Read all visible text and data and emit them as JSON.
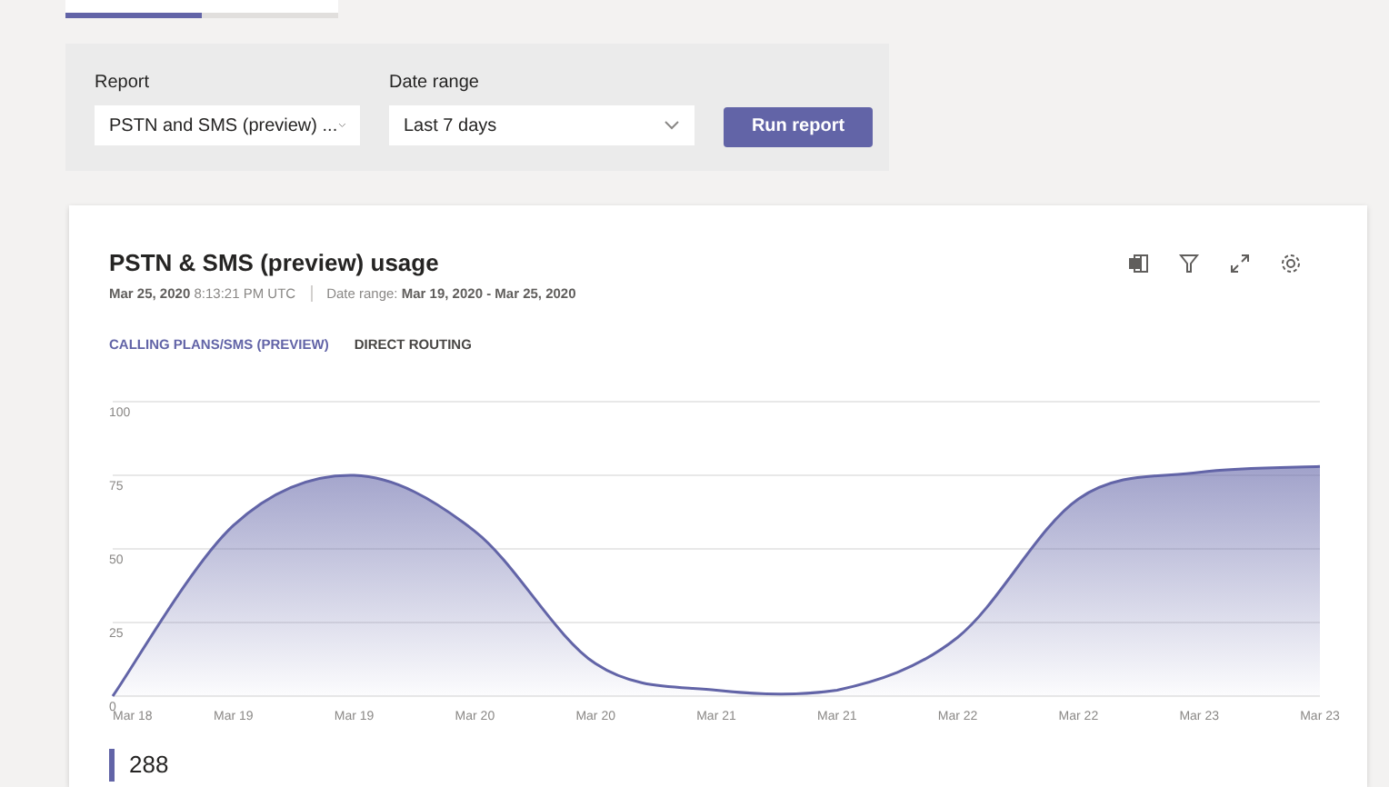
{
  "tabs": [
    {
      "selected": true
    },
    {
      "selected": false
    }
  ],
  "filters": {
    "report_label": "Report",
    "report_value": "PSTN and SMS (preview) ...",
    "date_label": "Date range",
    "date_value": "Last 7 days",
    "run_button": "Run report"
  },
  "card": {
    "title": "PSTN & SMS (preview) usage",
    "timestamp_date": "Mar 25, 2020",
    "timestamp_time": "8:13:21 PM UTC",
    "range_label": "Date range:",
    "range_value": "Mar 19, 2020 - Mar 25, 2020",
    "tabs": [
      {
        "label": "CALLING PLANS/SMS (PREVIEW)",
        "selected": true
      },
      {
        "label": "DIRECT ROUTING",
        "selected": false
      }
    ],
    "chart_data": {
      "type": "area",
      "categories": [
        "Mar 18",
        "Mar 19",
        "Mar 19",
        "Mar 20",
        "Mar 20",
        "Mar 21",
        "Mar 21",
        "Mar 22",
        "Mar 22",
        "Mar 23",
        "Mar 23"
      ],
      "grid": true,
      "series": [
        {
          "color": "#6264a7",
          "values": [
            0,
            58,
            75,
            56,
            11,
            2,
            2,
            20,
            67,
            76,
            78
          ]
        }
      ],
      "ylim": [
        0,
        100
      ],
      "yticks": [
        0,
        25,
        50,
        75,
        100
      ]
    },
    "total": "288"
  }
}
